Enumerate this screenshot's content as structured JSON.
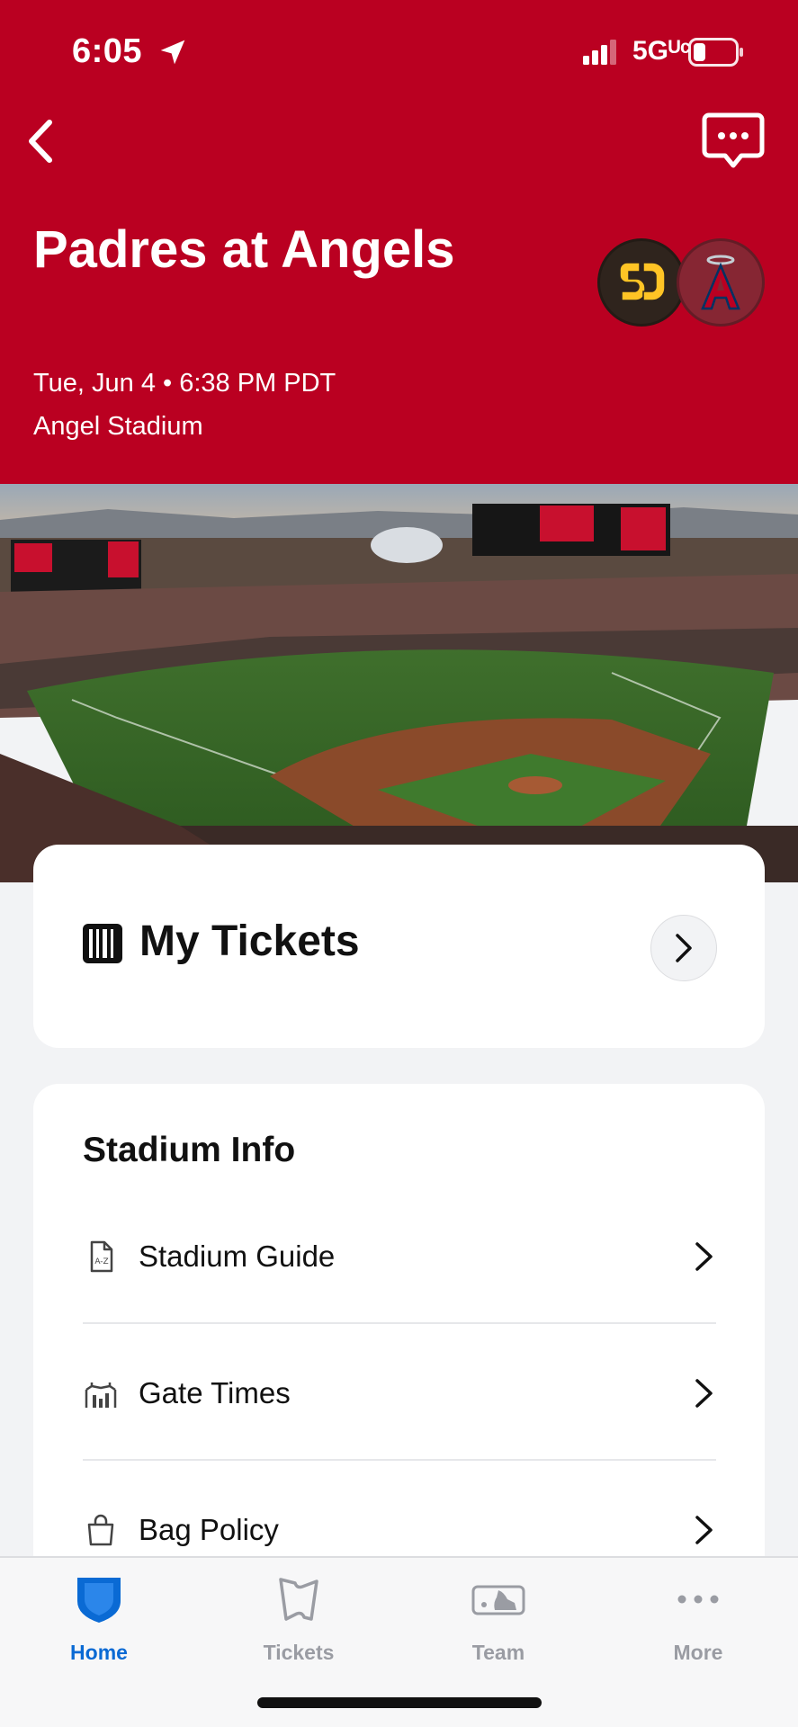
{
  "status_bar": {
    "time": "6:05",
    "network": "5Gᵁᶜ"
  },
  "header": {
    "title": "Padres at Angels",
    "datetime": "Tue, Jun 4 • 6:38 PM PDT",
    "venue": "Angel Stadium",
    "colors": {
      "background": "#BA0021"
    },
    "team_logos": [
      "padres-logo",
      "angels-logo"
    ]
  },
  "tickets": {
    "label": "My Tickets"
  },
  "stadium_info": {
    "title": "Stadium Info",
    "items": [
      {
        "label": "Stadium Guide",
        "icon": "document-az-icon"
      },
      {
        "label": "Gate Times",
        "icon": "gate-icon"
      },
      {
        "label": "Bag Policy",
        "icon": "bag-icon"
      }
    ]
  },
  "tabbar": {
    "items": [
      {
        "label": "Home",
        "icon": "home-shield-icon",
        "active": true
      },
      {
        "label": "Tickets",
        "icon": "ticket-icon",
        "active": false
      },
      {
        "label": "Team",
        "icon": "mlb-logo-icon",
        "active": false
      },
      {
        "label": "More",
        "icon": "more-dots-icon",
        "active": false
      }
    ],
    "active_color": "#0A6AD4"
  }
}
